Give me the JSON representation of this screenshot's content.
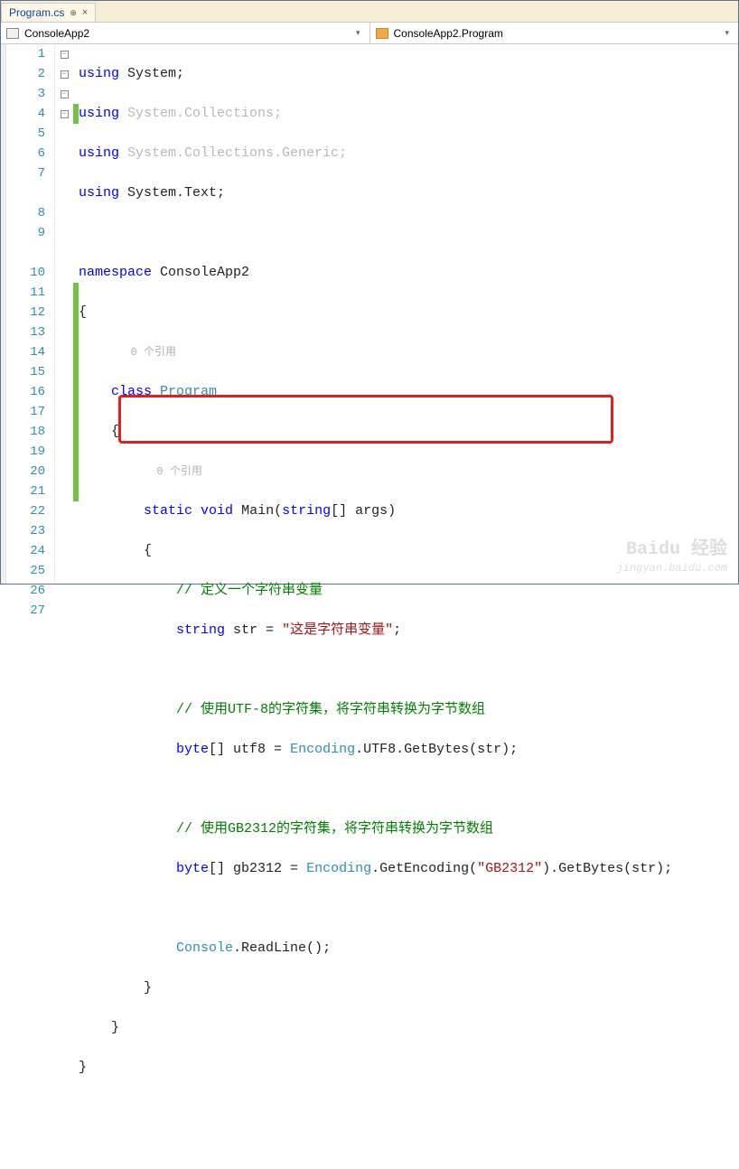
{
  "tab": {
    "title": "Program.cs"
  },
  "nav": {
    "left": "ConsoleApp2",
    "right": "ConsoleApp2.Program"
  },
  "refs": "0 个引用",
  "code": {
    "l1a": "using",
    "l1b": " System;",
    "l2a": "using",
    "l2b": " System.Collections;",
    "l3a": "using",
    "l3b": " System.Collections.Generic;",
    "l4a": "using",
    "l4b": " System.Text;",
    "l6a": "namespace",
    "l6b": " ConsoleApp2",
    "l7": "{",
    "l8a": "    ",
    "l8b": "class",
    "l8c": " ",
    "l8d": "Program",
    "l9": "    {",
    "l10a": "        ",
    "l10b": "static",
    "l10c": " ",
    "l10d": "void",
    "l10e": " Main(",
    "l10f": "string",
    "l10g": "[] args)",
    "l11": "        {",
    "l12a": "            ",
    "l12b": "// 定义一个字符串变量",
    "l13a": "            ",
    "l13b": "string",
    "l13c": " str = ",
    "l13d": "\"这是字符串变量\"",
    "l13e": ";",
    "l15a": "            ",
    "l15b": "// 使用UTF-8的字符集，将字符串转换为字节数组",
    "l16a": "            ",
    "l16b": "byte",
    "l16c": "[] utf8 = ",
    "l16d": "Encoding",
    "l16e": ".UTF8.GetBytes(str);",
    "l18a": "            ",
    "l18b": "// 使用GB2312的字符集，将字符串转换为字节数组",
    "l19a": "            ",
    "l19b": "byte",
    "l19c": "[] gb2312 = ",
    "l19d": "Encoding",
    "l19e": ".GetEncoding(",
    "l19f": "\"GB2312\"",
    "l19g": ").GetBytes(str);",
    "l21a": "            ",
    "l21b": "Console",
    "l21c": ".ReadLine();",
    "l22": "        }",
    "l23": "    }",
    "l24": "}"
  },
  "watermark": {
    "brand": "Baidu 经验",
    "url": "jingyan.baidu.com"
  }
}
